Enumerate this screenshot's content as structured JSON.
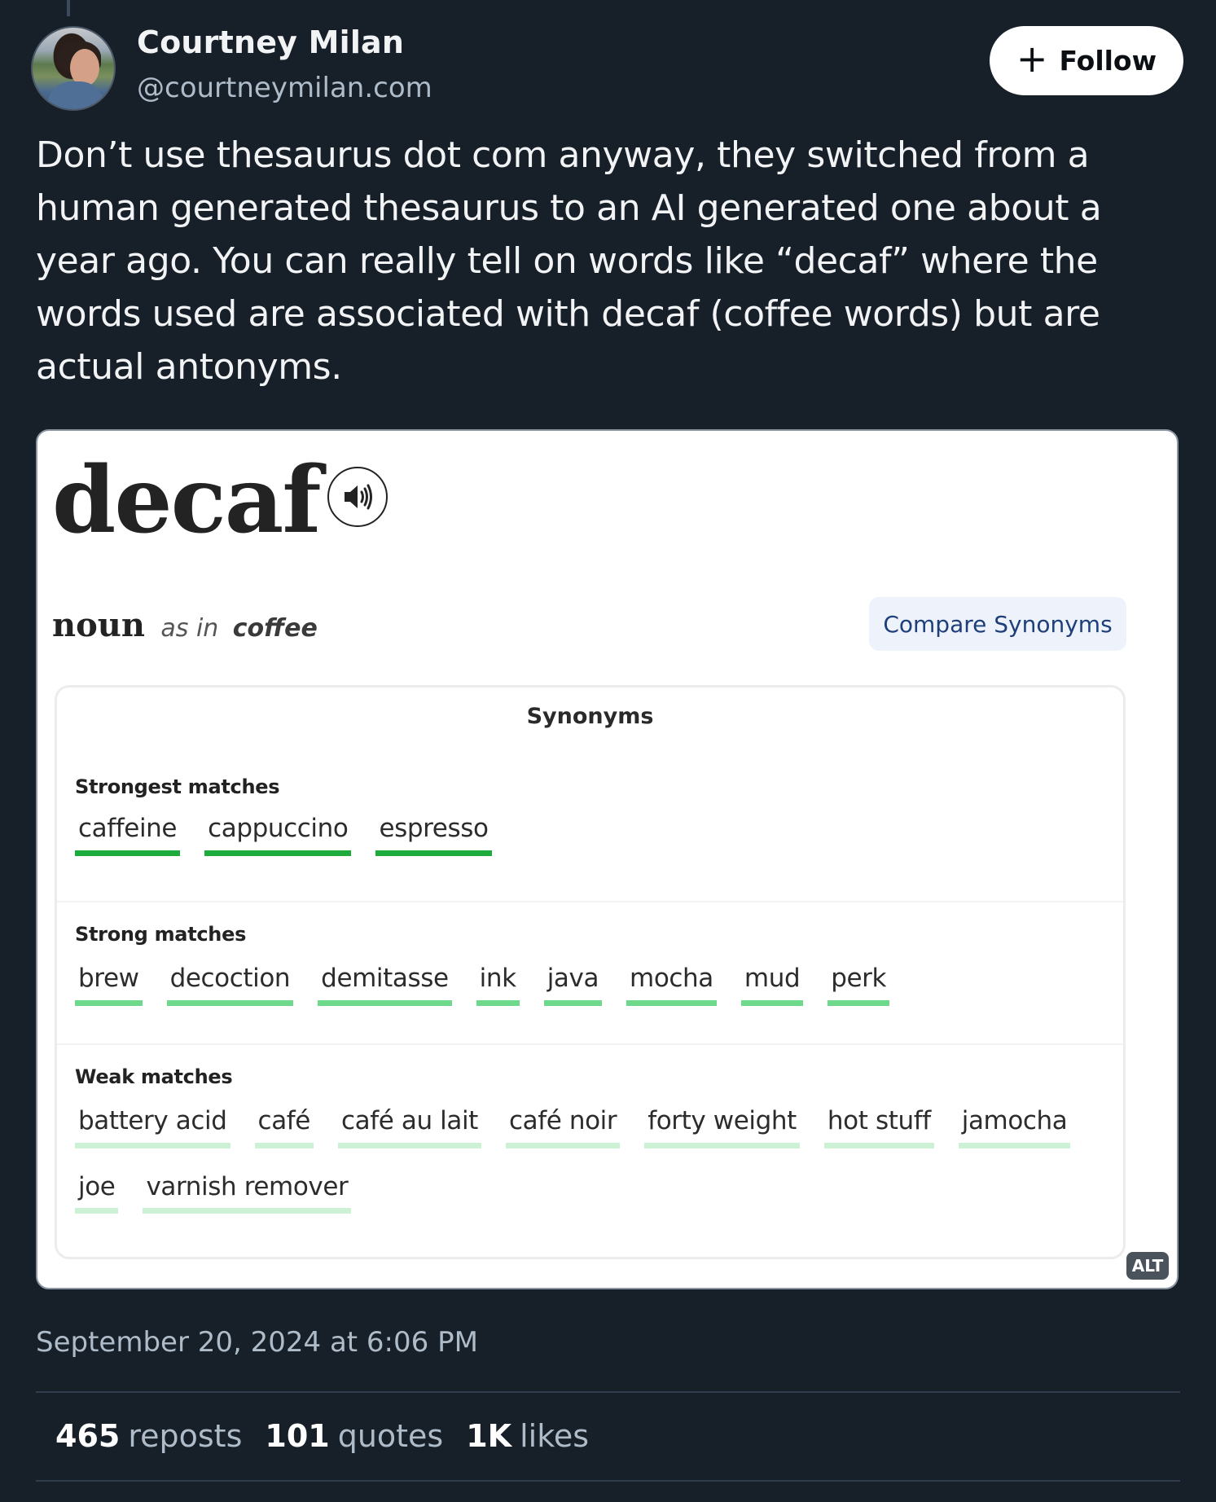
{
  "post": {
    "author": {
      "display_name": "Courtney Milan",
      "handle": "@courtneymilan.com",
      "avatar_icon": "avatar-photo"
    },
    "follow_button": {
      "icon": "plus-icon",
      "icon_glyph": "+",
      "label": "Follow"
    },
    "text": "Don’t use thesaurus dot com anyway, they switched from a\nhuman generated thesaurus to an AI generated one about a\nyear ago. You can really tell on words like “decaf” where the\nwords used are associated with decaf (coffee words) but are\nactual antonyms.",
    "timestamp": "September 20, 2024 at 6:06 PM",
    "stats": [
      {
        "count": "465",
        "label": "reposts"
      },
      {
        "count": "101",
        "label": "quotes"
      },
      {
        "count": "1K",
        "label": "likes"
      }
    ],
    "image": {
      "alt_badge": "ALT",
      "headword": "decaf",
      "audio_icon": "speaker-icon",
      "part_of_speech": "noun",
      "as_in_label": "as in",
      "sense": "coffee",
      "compare_button": "Compare Synonyms",
      "synonyms_title": "Synonyms",
      "groups": [
        {
          "label": "Strongest matches",
          "strength_color": "#1fab3c",
          "words": [
            "caffeine",
            "cappuccino",
            "espresso"
          ]
        },
        {
          "label": "Strong matches",
          "strength_color": "#6ed98a",
          "words": [
            "brew",
            "decoction",
            "demitasse",
            "ink",
            "java",
            "mocha",
            "mud",
            "perk"
          ]
        },
        {
          "label": "Weak matches",
          "strength_color": "#cdf1d5",
          "words": [
            "battery acid",
            "café",
            "café au lait",
            "café noir",
            "forty weight",
            "hot stuff",
            "jamocha",
            "joe",
            "varnish remover"
          ]
        }
      ]
    }
  },
  "colors": {
    "background": "#171f28",
    "text_primary": "#f1f3f5",
    "text_secondary": "#aebbc9",
    "divider": "#2f3d4e",
    "compare_button_bg": "#eef3fb",
    "compare_button_text": "#1f3f7a"
  }
}
